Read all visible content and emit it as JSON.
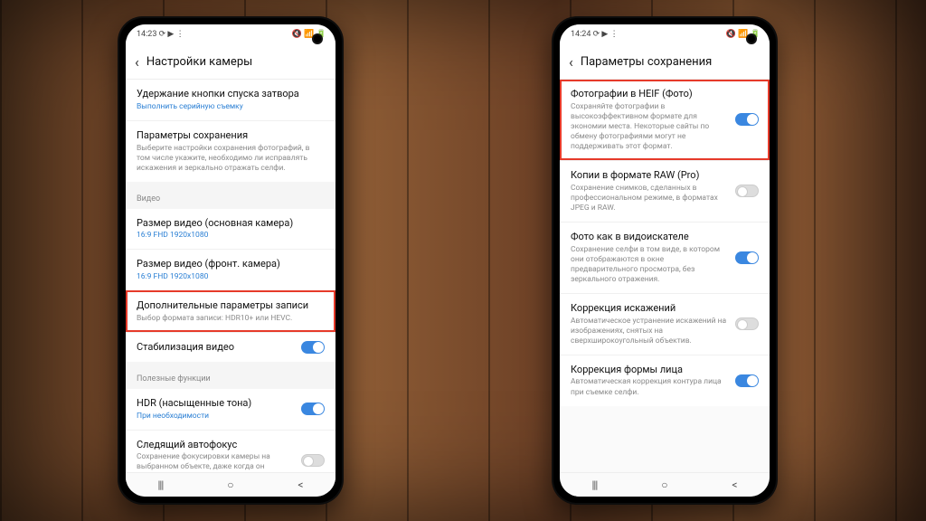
{
  "left": {
    "status": {
      "time": "14:23",
      "lefticons": "⟳ ▶ ⋮",
      "righticons": "🔇 📶 🔋"
    },
    "title": "Настройки камеры",
    "rows": {
      "shutter": {
        "t": "Удержание кнопки спуска затвора",
        "s": "Выполнить серийную съемку"
      },
      "saveopts": {
        "t": "Параметры сохранения",
        "s": "Выберите настройки сохранения фотографий, в том числе укажите, необходимо ли исправлять искажения и зеркально отражать селфи."
      },
      "grp_video": "Видео",
      "vidrear": {
        "t": "Размер видео (основная камера)",
        "s": "16:9 FHD 1920x1080"
      },
      "vidfront": {
        "t": "Размер видео (фронт. камера)",
        "s": "16:9 FHD 1920x1080"
      },
      "advrec": {
        "t": "Дополнительные параметры записи",
        "s": "Выбор формата записи: HDR10+ или HEVC."
      },
      "stab": {
        "t": "Стабилизация видео"
      },
      "grp_useful": "Полезные функции",
      "hdr": {
        "t": "HDR (насыщенные тона)",
        "s": "При необходимости"
      },
      "af": {
        "t": "Следящий автофокус",
        "s": "Сохранение фокусировки камеры на выбранном объекте, даже когда он движется."
      }
    }
  },
  "right": {
    "status": {
      "time": "14:24",
      "lefticons": "⟳ ▶ ⋮",
      "righticons": "🔇 📶 🔋"
    },
    "title": "Параметры сохранения",
    "rows": {
      "heif": {
        "t": "Фотографии в HEIF (Фото)",
        "s": "Сохраняйте фотографии в высокоэффективном формате для экономии места. Некоторые сайты по обмену фотографиями могут не поддерживать этот формат."
      },
      "raw": {
        "t": "Копии в формате RAW (Pro)",
        "s": "Сохранение снимков, сделанных в профессиональном режиме, в форматах JPEG и RAW."
      },
      "viewf": {
        "t": "Фото как в видоискателе",
        "s": "Сохранение селфи в том виде, в котором они отображаются в окне предварительного просмотра, без зеркального отражения."
      },
      "distort": {
        "t": "Коррекция искажений",
        "s": "Автоматическое устранение искажений на изображениях, снятых на сверхширокоугольный объектив."
      },
      "face": {
        "t": "Коррекция формы лица",
        "s": "Автоматическая коррекция контура лица при съемке селфи."
      }
    }
  },
  "nav": {
    "recent": "|||",
    "home": "○",
    "back": "<"
  }
}
